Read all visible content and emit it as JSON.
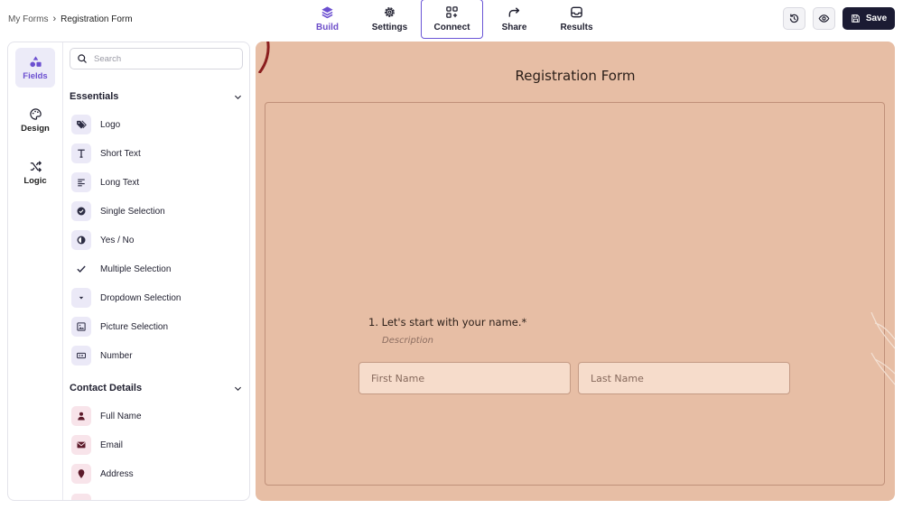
{
  "breadcrumb": {
    "root": "My Forms",
    "separator": "›",
    "current": "Registration Form"
  },
  "nav": [
    {
      "label": "Build",
      "icon": "layers-icon"
    },
    {
      "label": "Settings",
      "icon": "gear-icon"
    },
    {
      "label": "Connect",
      "icon": "grid-plus-icon"
    },
    {
      "label": "Share",
      "icon": "share-arrow-icon"
    },
    {
      "label": "Results",
      "icon": "inbox-icon"
    }
  ],
  "actions": {
    "history_icon": "history-icon",
    "preview_icon": "eye-icon",
    "save_label": "Save"
  },
  "rail": [
    {
      "label": "Fields",
      "icon": "shapes-icon",
      "active": true
    },
    {
      "label": "Design",
      "icon": "palette-icon"
    },
    {
      "label": "Logic",
      "icon": "shuffle-icon"
    }
  ],
  "search": {
    "placeholder": "Search",
    "value": ""
  },
  "sections": {
    "essentials": {
      "title": "Essentials",
      "items": [
        {
          "label": "Logo",
          "icon": "tag-icon"
        },
        {
          "label": "Short Text",
          "icon": "text-t-icon"
        },
        {
          "label": "Long Text",
          "icon": "align-left-icon"
        },
        {
          "label": "Single Selection",
          "icon": "check-circle-icon"
        },
        {
          "label": "Yes / No",
          "icon": "half-circle-icon"
        },
        {
          "label": "Multiple Selection",
          "icon": "checkmark-icon"
        },
        {
          "label": "Dropdown Selection",
          "icon": "dropdown-icon"
        },
        {
          "label": "Picture Selection",
          "icon": "picture-icon"
        },
        {
          "label": "Number",
          "icon": "number-icon"
        }
      ]
    },
    "contact": {
      "title": "Contact Details",
      "items": [
        {
          "label": "Full Name",
          "icon": "person-icon"
        },
        {
          "label": "Email",
          "icon": "mail-icon"
        },
        {
          "label": "Address",
          "icon": "location-pin-icon"
        }
      ]
    }
  },
  "form": {
    "title": "Registration Form",
    "question": "1. Let's start with your name.*",
    "description": "Description",
    "first_name_placeholder": "First Name",
    "last_name_placeholder": "Last Name"
  },
  "colors": {
    "accent": "#6b4fd0",
    "canvas_bg": "#e7bea5",
    "save_bg": "#1b1b33"
  }
}
